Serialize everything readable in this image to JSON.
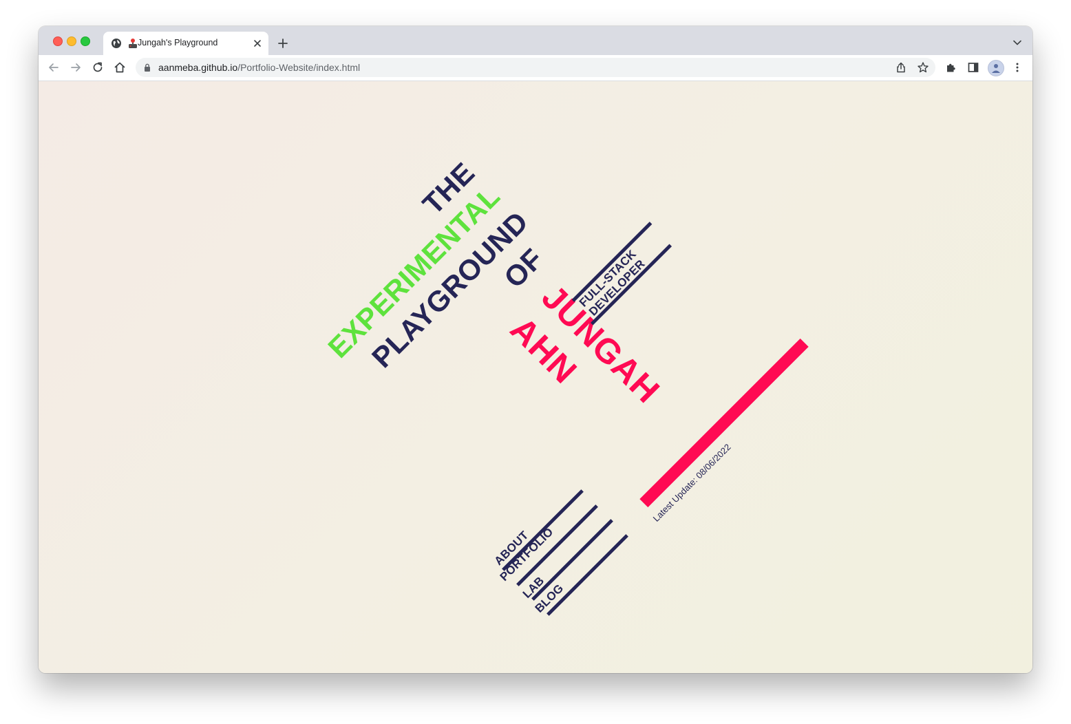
{
  "browser": {
    "tab_title": "Jungah's Playground",
    "url_host": "aanmeba.github.io",
    "url_path": "/Portfolio-Website/index.html"
  },
  "hero": {
    "word_the": "THE",
    "word_experimental": "EXPERIMENTAL",
    "word_playground": "PLAYGROUND",
    "word_of": "OF",
    "name_first": "JUNGAH",
    "name_last": "AHN",
    "role_line1": "FULL-STACK",
    "role_line2": "DEVELOPER"
  },
  "nav": {
    "items": [
      "ABOUT",
      "PORTFOLIO",
      "LAB",
      "BLOG"
    ]
  },
  "update_text": "Latest Update: 08/06/2022",
  "colors": {
    "navy": "#252556",
    "green": "#5ee23d",
    "pink": "#ff0a53",
    "page_bg": "#f3eee3"
  }
}
